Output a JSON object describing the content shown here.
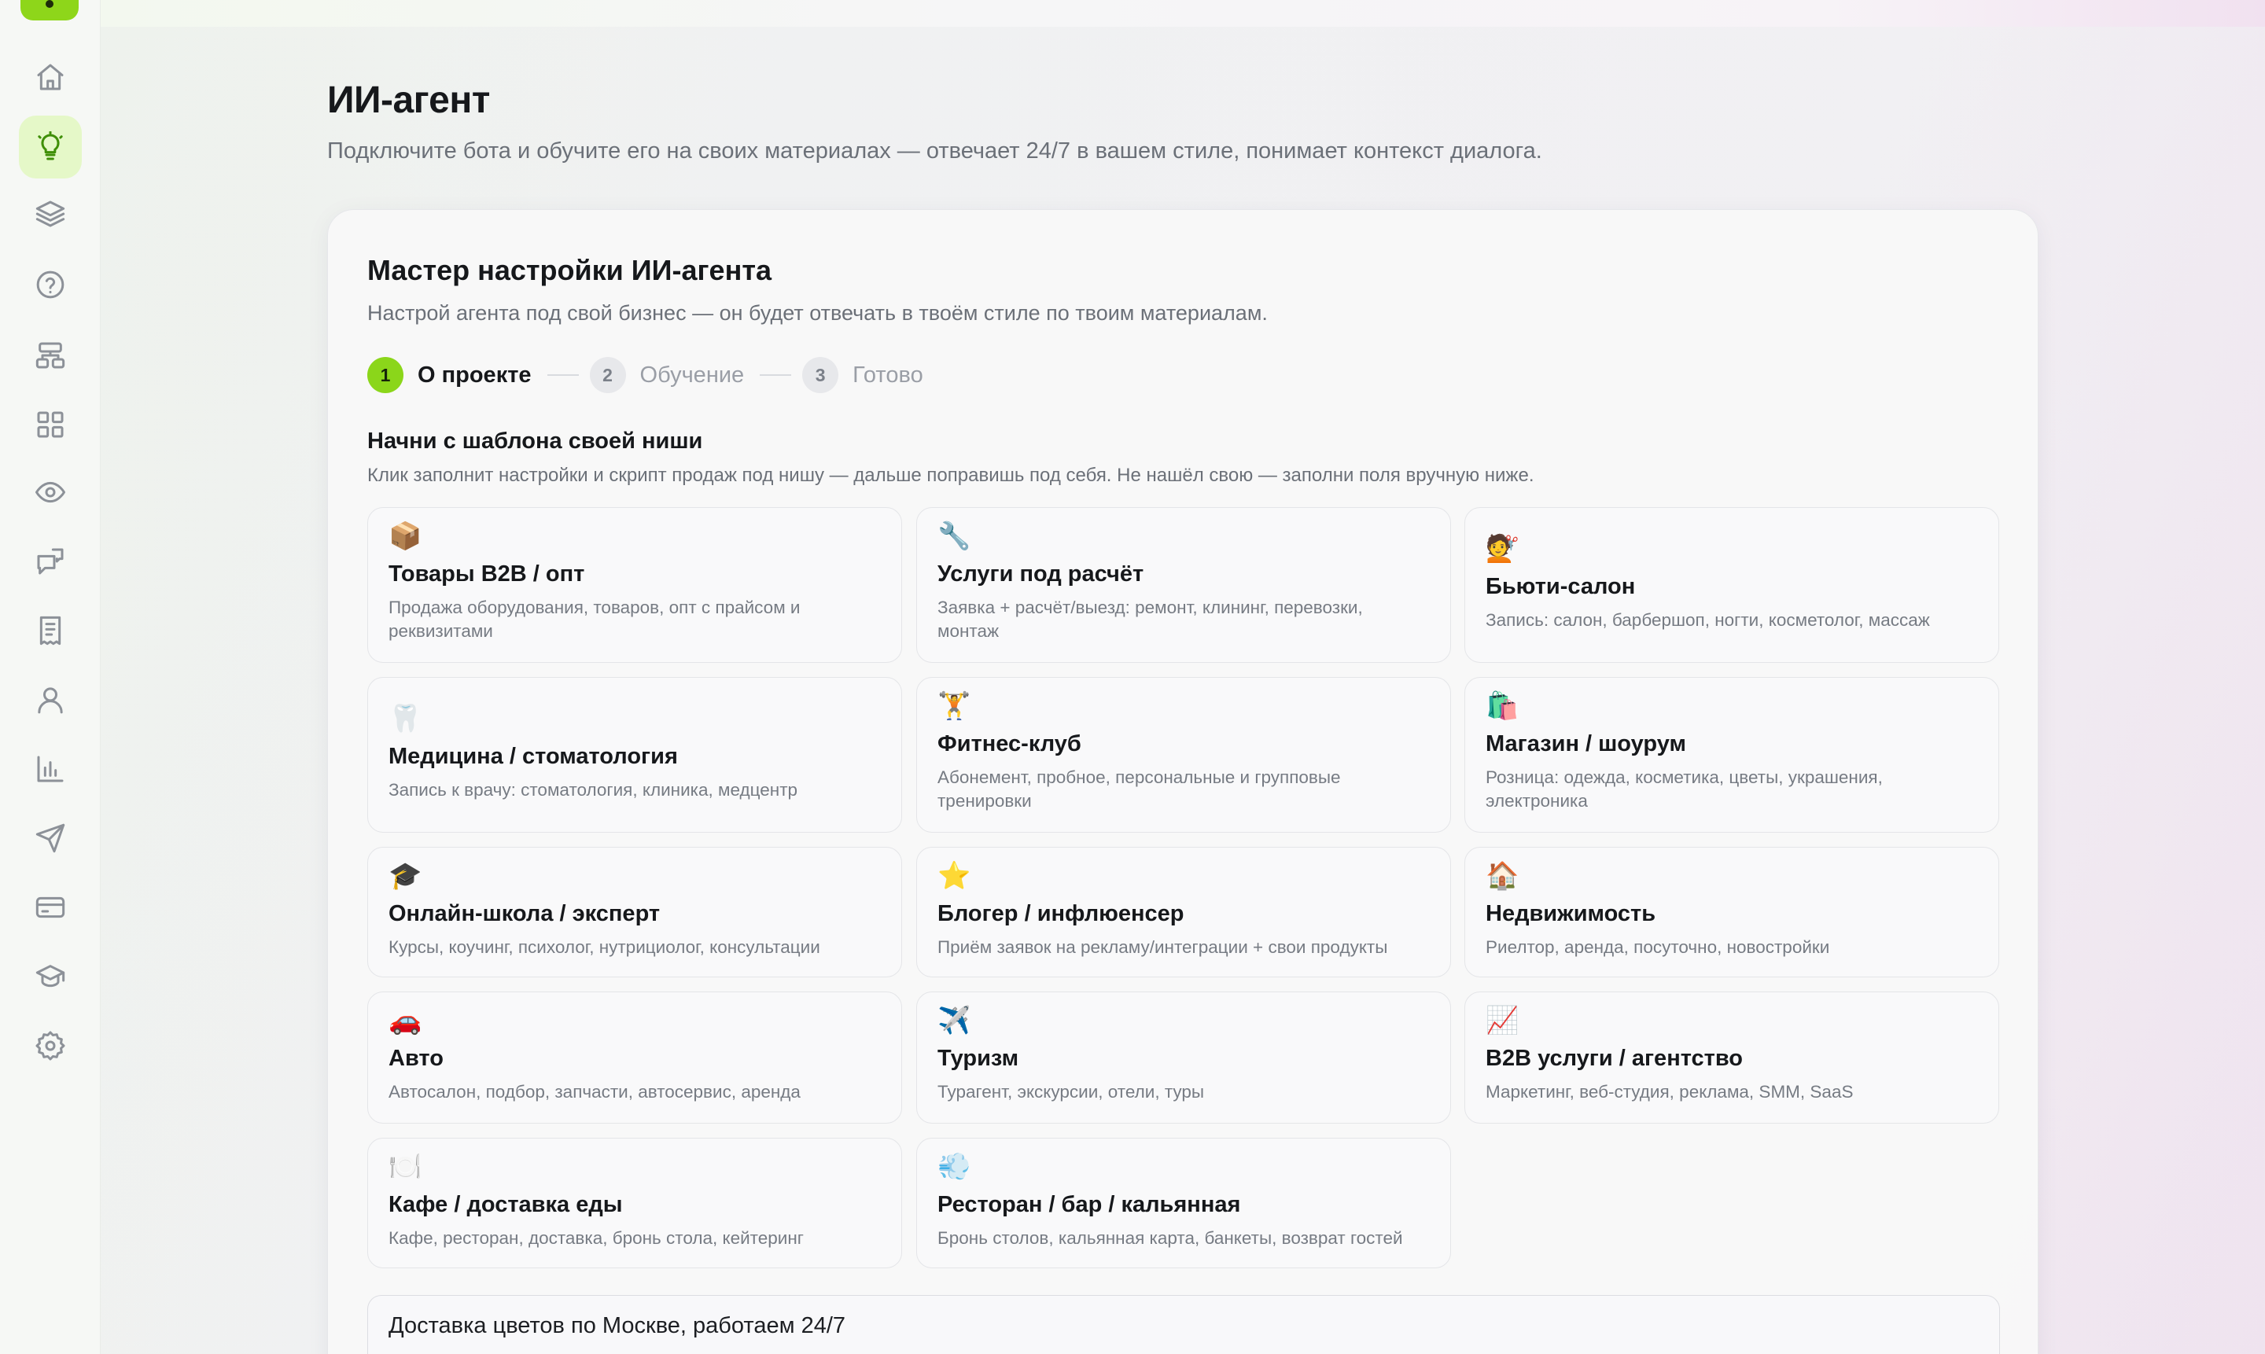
{
  "header": {
    "title": "ИИ-агент",
    "subtitle": "Подключите бота и обучите его на своих материалах — отвечает 24/7 в вашем стиле, понимает контекст диалога."
  },
  "sidebar": {
    "items": [
      {
        "icon": "home-icon",
        "active": false
      },
      {
        "icon": "lightbulb-icon",
        "active": true
      },
      {
        "icon": "layers-icon",
        "active": false
      },
      {
        "icon": "help-circle-icon",
        "active": false
      },
      {
        "icon": "flow-chart-icon",
        "active": false
      },
      {
        "icon": "grid-icon",
        "active": false
      },
      {
        "icon": "eye-icon",
        "active": false
      },
      {
        "icon": "messages-icon",
        "active": false
      },
      {
        "icon": "receipt-icon",
        "active": false
      },
      {
        "icon": "user-icon",
        "active": false
      },
      {
        "icon": "bar-chart-icon",
        "active": false
      },
      {
        "icon": "send-icon",
        "active": false
      },
      {
        "icon": "credit-card-icon",
        "active": false
      },
      {
        "icon": "graduation-cap-icon",
        "active": false
      },
      {
        "icon": "settings-icon",
        "active": false
      }
    ],
    "accent": "#8bd61a"
  },
  "wizard": {
    "title": "Мастер настройки ИИ-агента",
    "subtitle": "Настрой агента под свой бизнес — он будет отвечать в твоём стиле по твоим материалам.",
    "steps": [
      {
        "num": "1",
        "label": "О проекте",
        "active": true
      },
      {
        "num": "2",
        "label": "Обучение",
        "active": false
      },
      {
        "num": "3",
        "label": "Готово",
        "active": false
      }
    ],
    "niche_heading": "Начни с шаблона своей ниши",
    "niche_hint": "Клик заполнит настройки и скрипт продаж под нишу — дальше поправишь под себя. Не нашёл свою — заполни поля вручную ниже.",
    "templates": [
      {
        "emoji": "📦",
        "title": "Товары B2B / опт",
        "desc": "Продажа оборудования, товаров, опт с прайсом и реквизитами"
      },
      {
        "emoji": "🔧",
        "title": "Услуги под расчёт",
        "desc": "Заявка + расчёт/выезд: ремонт, клининг, перевозки, монтаж"
      },
      {
        "emoji": "💇",
        "title": "Бьюти-салон",
        "desc": "Запись: салон, барбершоп, ногти, косметолог, массаж"
      },
      {
        "emoji": "🦷",
        "title": "Медицина / стоматология",
        "desc": "Запись к врачу: стоматология, клиника, медцентр"
      },
      {
        "emoji": "🏋️",
        "title": "Фитнес-клуб",
        "desc": "Абонемент, пробное, персональные и групповые тренировки"
      },
      {
        "emoji": "🛍️",
        "title": "Магазин / шоурум",
        "desc": "Розница: одежда, косметика, цветы, украшения, электроника"
      },
      {
        "emoji": "🎓",
        "title": "Онлайн-школа / эксперт",
        "desc": "Курсы, коучинг, психолог, нутрициолог, консультации"
      },
      {
        "emoji": "⭐",
        "title": "Блогер / инфлюенсер",
        "desc": "Приём заявок на рекламу/интеграции + свои продукты"
      },
      {
        "emoji": "🏠",
        "title": "Недвижимость",
        "desc": "Риелтор, аренда, посуточно, новостройки"
      },
      {
        "emoji": "🚗",
        "title": "Авто",
        "desc": "Автосалон, подбор, запчасти, автосервис, аренда"
      },
      {
        "emoji": "✈️",
        "title": "Туризм",
        "desc": "Турагент, экскурсии, отели, туры"
      },
      {
        "emoji": "📈",
        "title": "B2B услуги / агентство",
        "desc": "Маркетинг, веб-студия, реклама, SMM, SaaS"
      },
      {
        "emoji": "🍽️",
        "title": "Кафе / доставка еды",
        "desc": "Кафе, ресторан, доставка, бронь стола, кейтеринг"
      },
      {
        "emoji": "💨",
        "title": "Ресторан / бар / кальянная",
        "desc": "Бронь столов, кальянная карта, банкеты, возврат гостей"
      }
    ],
    "business_description_value": "Доставка цветов по Москве, работаем 24/7"
  }
}
